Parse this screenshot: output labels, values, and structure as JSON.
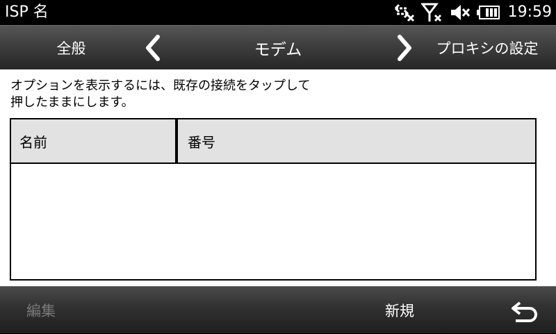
{
  "status_bar": {
    "title": "ISP 名",
    "time": "19:59",
    "icons": [
      "data-transfer-off-icon",
      "signal-off-icon",
      "speaker-muted-icon",
      "battery-icon"
    ]
  },
  "header": {
    "left_label": "全般",
    "center_label": "モデム",
    "right_label": "プロキシの設定",
    "prev_icon": "chevron-left-icon",
    "next_icon": "chevron-right-icon"
  },
  "content": {
    "instruction": "オプションを表示するには、既存の接続をタップして押したままにします。",
    "table": {
      "columns": [
        "名前",
        "番号"
      ],
      "rows": []
    }
  },
  "bottom_bar": {
    "edit_label": "編集",
    "new_label": "新規",
    "back_icon": "back-arrow-icon"
  },
  "colors": {
    "status_background": "#000000",
    "content_background": "#ffffff",
    "table_header_background": "#e2e2e2",
    "disabled_text": "#7a7a7a"
  }
}
